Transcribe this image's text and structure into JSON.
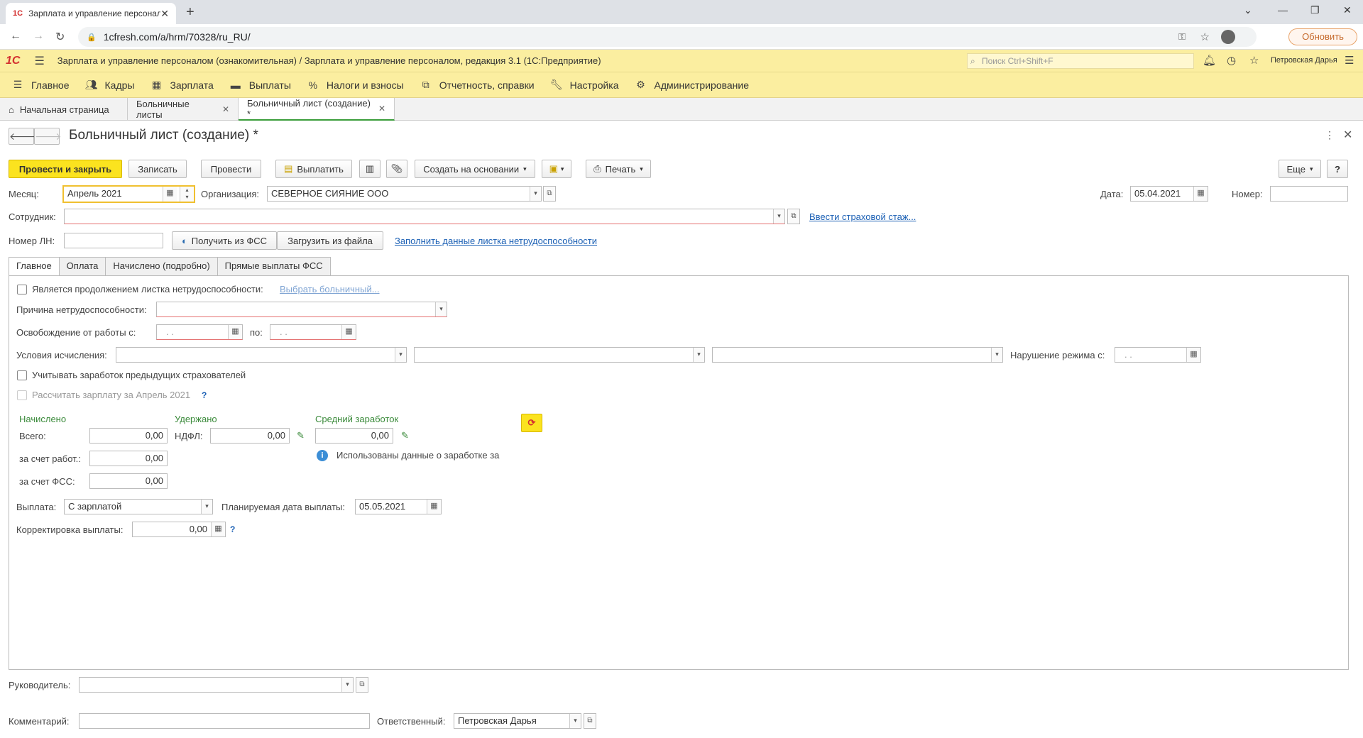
{
  "browser": {
    "tab_title": "Зарплата и управление персонал",
    "tab_favicon": "1C",
    "url": "1cfresh.com/a/hrm/70328/ru_RU/",
    "update_button": "Обновить"
  },
  "app": {
    "logo": "1C",
    "title": "Зарплата и управление персоналом (ознакомительная) / Зарплата и управление персоналом, редакция 3.1  (1С:Предприятие)",
    "search_placeholder": "Поиск Ctrl+Shift+F",
    "user": "Петровская Дарья"
  },
  "menu": [
    {
      "label": "Главное",
      "icon": "menu-icon"
    },
    {
      "label": "Кадры",
      "icon": "people-icon"
    },
    {
      "label": "Зарплата",
      "icon": "calculator-icon"
    },
    {
      "label": "Выплаты",
      "icon": "wallet-icon"
    },
    {
      "label": "Налоги и взносы",
      "icon": "percent-icon"
    },
    {
      "label": "Отчетность, справки",
      "icon": "report-icon"
    },
    {
      "label": "Настройка",
      "icon": "wrench-icon"
    },
    {
      "label": "Администрирование",
      "icon": "gear-icon"
    }
  ],
  "open_tabs": [
    {
      "label": "Начальная страница"
    },
    {
      "label": "Больничные листы"
    },
    {
      "label": "Больничный лист (создание) *"
    }
  ],
  "form": {
    "title": "Больничный лист (создание) *",
    "toolbar": {
      "post_close": "Провести и закрыть",
      "save": "Записать",
      "post": "Провести",
      "pay": "Выплатить",
      "create_based": "Создать на основании",
      "print": "Печать",
      "more": "Еще",
      "help": "?"
    },
    "month_label": "Месяц:",
    "month_value": "Апрель 2021",
    "org_label": "Организация:",
    "org_value": "СЕВЕРНОЕ СИЯНИЕ ООО",
    "date_label": "Дата:",
    "date_value": "05.04.2021",
    "number_label": "Номер:",
    "number_value": "",
    "employee_label": "Сотрудник:",
    "employee_value": "",
    "insurance_link": "Ввести страховой стаж...",
    "ln_label": "Номер ЛН:",
    "ln_value": "",
    "get_fss": "Получить из ФСС",
    "load_file": "Загрузить из файла",
    "fill_link": "Заполнить данные листка нетрудоспособности",
    "tabs": [
      "Главное",
      "Оплата",
      "Начислено (подробно)",
      "Прямые выплаты ФСС"
    ],
    "main": {
      "continuation_label": "Является продолжением листка нетрудоспособности:",
      "choose_sick": "Выбрать больничный...",
      "reason_label": "Причина нетрудоспособности:",
      "release_label": "Освобождение от работы с:",
      "release_from": ". .",
      "to_label": "по:",
      "release_to": ". .",
      "conditions_label": "Условия исчисления:",
      "violation_label": "Нарушение режима с:",
      "violation_value": ". .",
      "prev_insurers_label": "Учитывать заработок предыдущих страхователей",
      "calc_salary_label": "Рассчитать зарплату за Апрель 2021",
      "accrued_header": "Начислено",
      "total_label": "Всего:",
      "total_value": "0,00",
      "employer_label": "за счет работ.:",
      "employer_value": "0,00",
      "fss_label": "за счет ФСС:",
      "fss_value": "0,00",
      "withheld_header": "Удержано",
      "ndfl_label": "НДФЛ:",
      "ndfl_value": "0,00",
      "avg_header": "Средний заработок",
      "avg_value": "0,00",
      "info_text": "Использованы данные о заработке за",
      "payout_label": "Выплата:",
      "payout_value": "С зарплатой",
      "planned_date_label": "Планируемая дата выплаты:",
      "planned_date_value": "05.05.2021",
      "correction_label": "Корректировка выплаты:",
      "correction_value": "0,00"
    },
    "head_label": "Руководитель:",
    "head_value": "",
    "comment_label": "Комментарий:",
    "comment_value": "",
    "responsible_label": "Ответственный:",
    "responsible_value": "Петровская Дарья"
  }
}
